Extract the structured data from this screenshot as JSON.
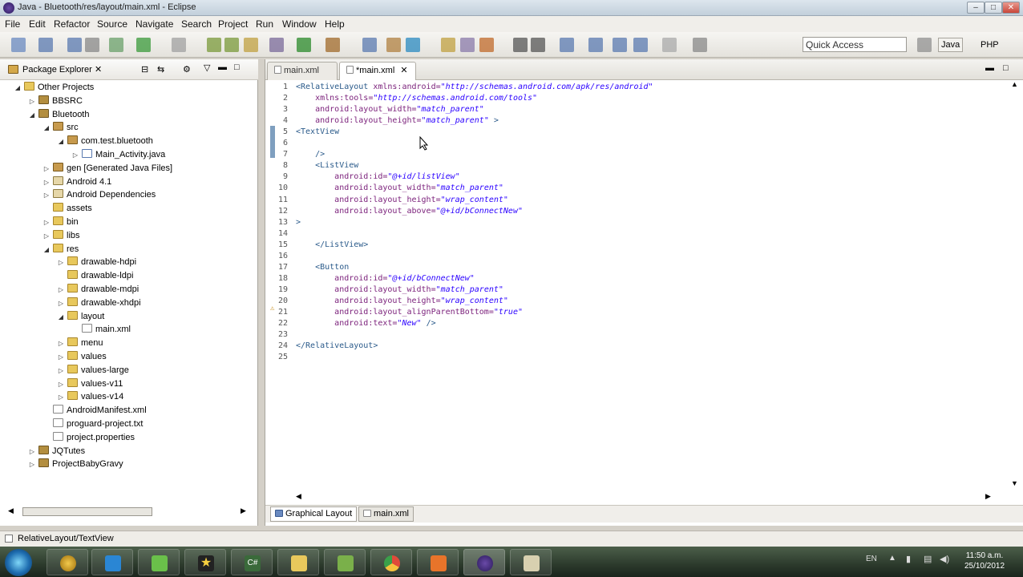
{
  "window": {
    "title": "Java - Bluetooth/res/layout/main.xml - Eclipse"
  },
  "menu": [
    "File",
    "Edit",
    "Refactor",
    "Source",
    "Navigate",
    "Search",
    "Project",
    "Run",
    "Window",
    "Help"
  ],
  "toolbar": {
    "quick_access_placeholder": "Quick Access",
    "perspective_java": "Java",
    "perspective_php": "PHP"
  },
  "package_explorer": {
    "title": "Package Explorer",
    "tree": [
      {
        "label": "Other Projects",
        "indent": 0,
        "twisty": "down",
        "icon": "folder"
      },
      {
        "label": "BBSRC",
        "indent": 1,
        "twisty": "right",
        "icon": "proj"
      },
      {
        "label": "Bluetooth",
        "indent": 1,
        "twisty": "down",
        "icon": "proj"
      },
      {
        "label": "src",
        "indent": 2,
        "twisty": "down",
        "icon": "pkg"
      },
      {
        "label": "com.test.bluetooth",
        "indent": 3,
        "twisty": "down",
        "icon": "pkg"
      },
      {
        "label": "Main_Activity.java",
        "indent": 4,
        "twisty": "right",
        "icon": "java"
      },
      {
        "label": "gen [Generated Java Files]",
        "indent": 2,
        "twisty": "right",
        "icon": "pkg"
      },
      {
        "label": "Android 4.1",
        "indent": 2,
        "twisty": "right",
        "icon": "lib"
      },
      {
        "label": "Android Dependencies",
        "indent": 2,
        "twisty": "right",
        "icon": "lib"
      },
      {
        "label": "assets",
        "indent": 2,
        "twisty": "",
        "icon": "folder"
      },
      {
        "label": "bin",
        "indent": 2,
        "twisty": "right",
        "icon": "folder"
      },
      {
        "label": "libs",
        "indent": 2,
        "twisty": "right",
        "icon": "folder"
      },
      {
        "label": "res",
        "indent": 2,
        "twisty": "down",
        "icon": "folder"
      },
      {
        "label": "drawable-hdpi",
        "indent": 3,
        "twisty": "right",
        "icon": "folder"
      },
      {
        "label": "drawable-ldpi",
        "indent": 3,
        "twisty": "",
        "icon": "folder"
      },
      {
        "label": "drawable-mdpi",
        "indent": 3,
        "twisty": "right",
        "icon": "folder"
      },
      {
        "label": "drawable-xhdpi",
        "indent": 3,
        "twisty": "right",
        "icon": "folder"
      },
      {
        "label": "layout",
        "indent": 3,
        "twisty": "down",
        "icon": "folder"
      },
      {
        "label": "main.xml",
        "indent": 4,
        "twisty": "",
        "icon": "file"
      },
      {
        "label": "menu",
        "indent": 3,
        "twisty": "right",
        "icon": "folder"
      },
      {
        "label": "values",
        "indent": 3,
        "twisty": "right",
        "icon": "folder"
      },
      {
        "label": "values-large",
        "indent": 3,
        "twisty": "right",
        "icon": "folder"
      },
      {
        "label": "values-v11",
        "indent": 3,
        "twisty": "right",
        "icon": "folder"
      },
      {
        "label": "values-v14",
        "indent": 3,
        "twisty": "right",
        "icon": "folder"
      },
      {
        "label": "AndroidManifest.xml",
        "indent": 2,
        "twisty": "",
        "icon": "file"
      },
      {
        "label": "proguard-project.txt",
        "indent": 2,
        "twisty": "",
        "icon": "file"
      },
      {
        "label": "project.properties",
        "indent": 2,
        "twisty": "",
        "icon": "file"
      },
      {
        "label": "JQTutes",
        "indent": 1,
        "twisty": "right",
        "icon": "proj"
      },
      {
        "label": "ProjectBabyGravy",
        "indent": 1,
        "twisty": "right",
        "icon": "proj"
      }
    ]
  },
  "editor": {
    "tabs": [
      {
        "label": "main.xml"
      },
      {
        "label": "*main.xml"
      }
    ],
    "lines": [
      {
        "n": "1",
        "parts": [
          [
            "t",
            "<RelativeLayout "
          ],
          [
            "a",
            "xmlns:android="
          ],
          [
            "v",
            "\"http://schemas.android.com/apk/res/android\""
          ]
        ]
      },
      {
        "n": "2",
        "parts": [
          [
            "p",
            "    "
          ],
          [
            "a",
            "xmlns:tools="
          ],
          [
            "v",
            "\"http://schemas.android.com/tools\""
          ]
        ]
      },
      {
        "n": "3",
        "parts": [
          [
            "p",
            "    "
          ],
          [
            "a",
            "android:layout_width="
          ],
          [
            "v",
            "\"match_parent\""
          ]
        ]
      },
      {
        "n": "4",
        "parts": [
          [
            "p",
            "    "
          ],
          [
            "a",
            "android:layout_height="
          ],
          [
            "v",
            "\"match_parent\""
          ],
          [
            "t",
            " >"
          ]
        ]
      },
      {
        "n": "5",
        "parts": [
          [
            "t",
            "<TextView"
          ]
        ]
      },
      {
        "n": "6",
        "parts": []
      },
      {
        "n": "7",
        "parts": [
          [
            "p",
            "    "
          ],
          [
            "t",
            "/>"
          ]
        ]
      },
      {
        "n": "8",
        "parts": [
          [
            "p",
            "    "
          ],
          [
            "t",
            "<ListView"
          ]
        ]
      },
      {
        "n": "9",
        "parts": [
          [
            "p",
            "        "
          ],
          [
            "a",
            "android:id="
          ],
          [
            "v",
            "\"@+id/listView\""
          ]
        ]
      },
      {
        "n": "10",
        "parts": [
          [
            "p",
            "        "
          ],
          [
            "a",
            "android:layout_width="
          ],
          [
            "v",
            "\"match_parent\""
          ]
        ]
      },
      {
        "n": "11",
        "parts": [
          [
            "p",
            "        "
          ],
          [
            "a",
            "android:layout_height="
          ],
          [
            "v",
            "\"wrap_content\""
          ]
        ]
      },
      {
        "n": "12",
        "parts": [
          [
            "p",
            "        "
          ],
          [
            "a",
            "android:layout_above="
          ],
          [
            "v",
            "\"@+id/bConnectNew\""
          ]
        ]
      },
      {
        "n": "13",
        "parts": [
          [
            "t",
            ">"
          ]
        ]
      },
      {
        "n": "14",
        "parts": []
      },
      {
        "n": "15",
        "parts": [
          [
            "p",
            "    "
          ],
          [
            "t",
            "</ListView>"
          ]
        ]
      },
      {
        "n": "16",
        "parts": []
      },
      {
        "n": "17",
        "parts": [
          [
            "p",
            "    "
          ],
          [
            "t",
            "<Button"
          ]
        ]
      },
      {
        "n": "18",
        "parts": [
          [
            "p",
            "        "
          ],
          [
            "a",
            "android:id="
          ],
          [
            "v",
            "\"@+id/bConnectNew\""
          ]
        ]
      },
      {
        "n": "19",
        "parts": [
          [
            "p",
            "        "
          ],
          [
            "a",
            "android:layout_width="
          ],
          [
            "v",
            "\"match_parent\""
          ]
        ]
      },
      {
        "n": "20",
        "parts": [
          [
            "p",
            "        "
          ],
          [
            "a",
            "android:layout_height="
          ],
          [
            "v",
            "\"wrap_content\""
          ]
        ]
      },
      {
        "n": "21",
        "parts": [
          [
            "p",
            "        "
          ],
          [
            "a",
            "android:layout_alignParentBottom="
          ],
          [
            "v",
            "\"true\""
          ]
        ]
      },
      {
        "n": "22",
        "parts": [
          [
            "p",
            "        "
          ],
          [
            "a",
            "android:text="
          ],
          [
            "v",
            "\"New\""
          ],
          [
            "t",
            " />"
          ]
        ]
      },
      {
        "n": "23",
        "parts": []
      },
      {
        "n": "24",
        "parts": [
          [
            "t",
            "</RelativeLayout>"
          ]
        ]
      },
      {
        "n": "25",
        "parts": []
      }
    ],
    "bottom_tabs": [
      "Graphical Layout",
      "main.xml"
    ]
  },
  "status": {
    "text": "RelativeLayout/TextView"
  },
  "taskbar": {
    "time": "11:50 a.m.",
    "date": "25/10/2012"
  }
}
